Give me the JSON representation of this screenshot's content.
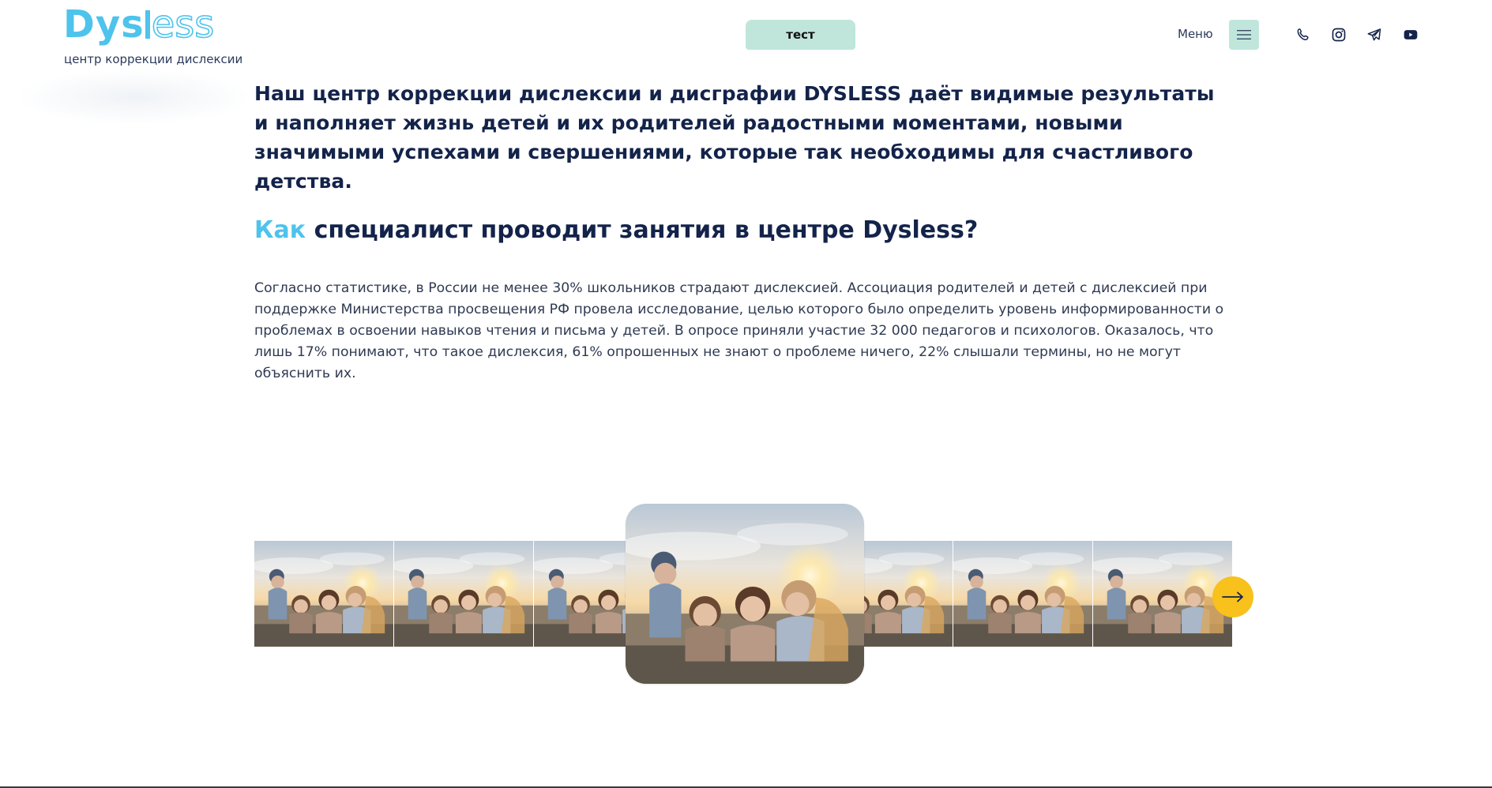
{
  "header": {
    "logo_left": "Dys",
    "logo_right": "ess",
    "tagline": "центр коррекции дислексии",
    "test_label": "тест",
    "menu_label": "Меню",
    "icons": [
      "phone-icon",
      "instagram-icon",
      "telegram-icon",
      "youtube-icon",
      "hamburger-icon"
    ]
  },
  "content": {
    "intro": "Наш центр коррекции дислексии и дисграфии DYSLESS даёт видимые результаты и наполняет жизнь детей и их родителей радостными моментами, новыми значимыми успехами и свершениями, которые так необходимы для счастливого детства.",
    "heading_accent": "Как",
    "heading_rest": " специалист проводит занятия в центре Dysless?",
    "paragraph": "Согласно статистике, в России не менее 30% школьников страдают дислексией. Ассоциация родителей и детей с дислексией при поддержке Министерства просвещения РФ провела исследование, целью которого было определить уровень информированности о проблемах в освоении навыков чтения и письма у детей. В опросе приняли участие 32 000 педагогов и психологов. Оказалось, что лишь 17% понимают, что такое дислексия, 61% опрошенных не знают о проблеме ничего, 22% слышали термины, но не могут объяснить их."
  },
  "colors": {
    "accent": "#4ec3ec",
    "mint": "#c0e6dc",
    "navy": "#13234a",
    "yellow": "#f8c11b"
  }
}
